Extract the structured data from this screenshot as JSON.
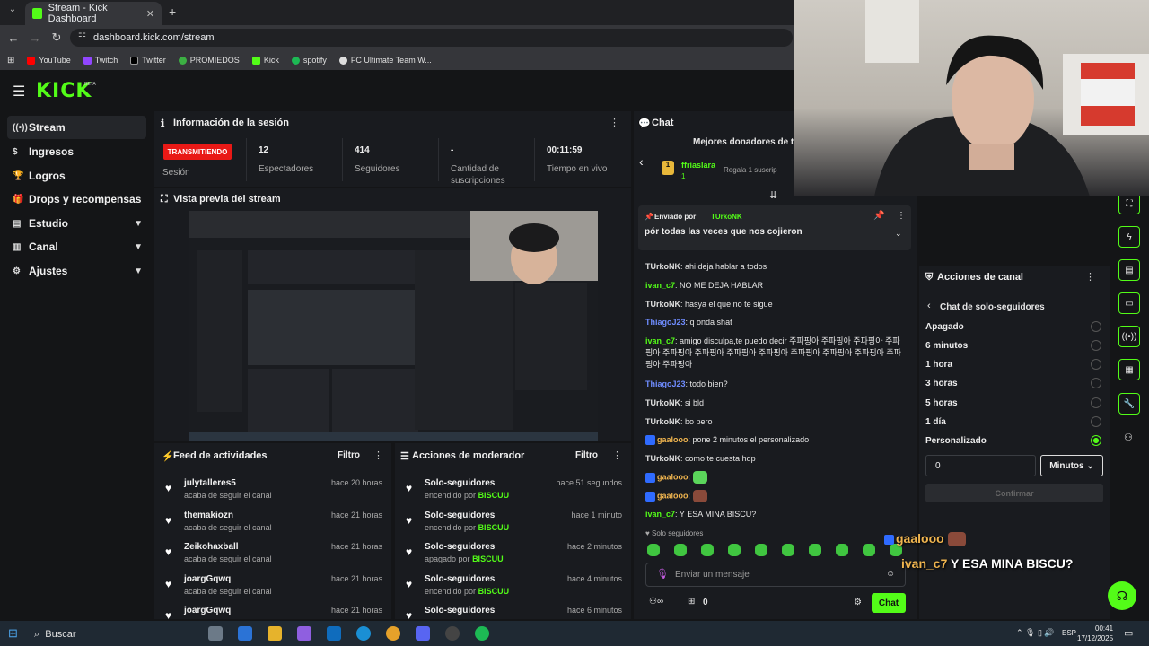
{
  "browser": {
    "tab_title": "Stream - Kick Dashboard",
    "url": "dashboard.kick.com/stream",
    "bookmarks": [
      "YouTube",
      "Twitch",
      "Twitter",
      "PROMIEDOS",
      "Kick",
      "spotify",
      "FC Ultimate Team W..."
    ]
  },
  "brand": {
    "logo": "KICK",
    "beta": "BETA",
    "accent": "#53fc18"
  },
  "sidebar": {
    "items": [
      {
        "label": "Stream",
        "icon": "stream-icon"
      },
      {
        "label": "Ingresos",
        "icon": "dollar-icon"
      },
      {
        "label": "Logros",
        "icon": "trophy-icon"
      },
      {
        "label": "Drops y recompensas",
        "icon": "gift-icon"
      },
      {
        "label": "Estudio",
        "icon": "studio-icon"
      },
      {
        "label": "Canal",
        "icon": "channel-icon"
      },
      {
        "label": "Ajustes",
        "icon": "gear-icon"
      }
    ]
  },
  "session": {
    "title": "Información de la sesión",
    "status_badge": "TRANSMITIENDO",
    "status_label": "Sesión",
    "stats": [
      {
        "value": "12",
        "label": "Espectadores"
      },
      {
        "value": "414",
        "label": "Seguidores"
      },
      {
        "value": "-",
        "label": "Cantidad de suscripciones"
      },
      {
        "value": "00:11:59",
        "label": "Tiempo en vivo"
      }
    ]
  },
  "preview": {
    "title": "Vista previa del stream"
  },
  "feed": {
    "title": "Feed de actividades",
    "filter_label": "Filtro",
    "rows": [
      {
        "name": "julytalleres5",
        "sub": "acaba de seguir el canal",
        "time": "hace 20 horas"
      },
      {
        "name": "themakiozn",
        "sub": "acaba de seguir el canal",
        "time": "hace 21 horas"
      },
      {
        "name": "Zeikohaxball",
        "sub": "acaba de seguir el canal",
        "time": "hace 21 horas"
      },
      {
        "name": "joargGqwq",
        "sub": "acaba de seguir el canal",
        "time": "hace 21 horas"
      },
      {
        "name": "joargGqwq",
        "sub": "",
        "time": "hace 21 horas"
      }
    ]
  },
  "mod": {
    "title": "Acciones de moderador",
    "filter_label": "Filtro",
    "rows": [
      {
        "name": "Solo-seguidores",
        "action": "encendido por",
        "by": "BISCUU",
        "time": "hace 51 segundos"
      },
      {
        "name": "Solo-seguidores",
        "action": "encendido por",
        "by": "BISCUU",
        "time": "hace 1 minuto"
      },
      {
        "name": "Solo-seguidores",
        "action": "apagado por",
        "by": "BISCUU",
        "time": "hace 2 minutos"
      },
      {
        "name": "Solo-seguidores",
        "action": "encendido por",
        "by": "BISCUU",
        "time": "hace 4 minutos"
      },
      {
        "name": "Solo-seguidores",
        "action": "",
        "by": "",
        "time": "hace 6 minutos"
      }
    ]
  },
  "chat": {
    "title": "Chat",
    "donors_title": "Mejores donadores de to",
    "donor": {
      "name": "ffriaslara",
      "count": "1",
      "text": "Regala 1 suscrip"
    },
    "pinned": {
      "by_label": "Enviado por",
      "by": "TUrkoNK",
      "text": "pór todas las veces que nos cojieron"
    },
    "messages": [
      {
        "user": "TUrkoNK",
        "color": "u1",
        "text": "ahi deja hablar a todos"
      },
      {
        "user": "ivan_c7",
        "color": "u2",
        "text": "NO ME DEJA HABLAR"
      },
      {
        "user": "TUrkoNK",
        "color": "u1",
        "text": "hasya el que no te sigue"
      },
      {
        "user": "ThiagoJ23",
        "color": "u3",
        "text": "q onda shat"
      },
      {
        "user": "ivan_c7",
        "color": "u2",
        "text": "amigo disculpa,te puedo decir 주파핑아 주파핑아 주파핑아 주파핑아 주파핑아 주파핑아 주파핑아 주파핑아 주파핑아 주파핑아 주파핑아 주파핑아 주파핑아"
      },
      {
        "user": "ThiagoJ23",
        "color": "u3",
        "text": "todo bien?"
      },
      {
        "user": "TUrkoNK",
        "color": "u1",
        "text": "si bld"
      },
      {
        "user": "TUrkoNK",
        "color": "u1",
        "text": "bo pero"
      },
      {
        "user": "gaalooo",
        "color": "u4",
        "text": "pone 2 minutos el personalizado"
      },
      {
        "user": "TUrkoNK",
        "color": "u1",
        "text": "como te cuesta hdp"
      },
      {
        "user": "gaalooo",
        "color": "u4",
        "text": ""
      },
      {
        "user": "gaalooo",
        "color": "u4",
        "text": ""
      },
      {
        "user": "ivan_c7",
        "color": "u2",
        "text": "Y ESA MINA BISCU?"
      }
    ],
    "solo_label": "Solo seguidores",
    "input_placeholder": "Enviar un mensaje",
    "points": "0",
    "send_label": "Chat"
  },
  "channel_actions": {
    "title": "Acciones de canal",
    "back_label": "Chat de solo-seguidores",
    "options": [
      "Apagado",
      "6 minutos",
      "1 hora",
      "3 horas",
      "5 horas",
      "1 día",
      "Personalizado"
    ],
    "selected_index": 6,
    "custom_value": "0",
    "unit_label": "Minutos",
    "confirm_label": "Confirmar"
  },
  "overlay": {
    "line1_user": "gaalooo",
    "line2_user": "ivan_c7",
    "line2_text": "Y ESA MINA BISCU?"
  },
  "taskbar": {
    "search": "Buscar",
    "lang": "ESP",
    "time": "00:41",
    "date": "17/12/2025"
  }
}
